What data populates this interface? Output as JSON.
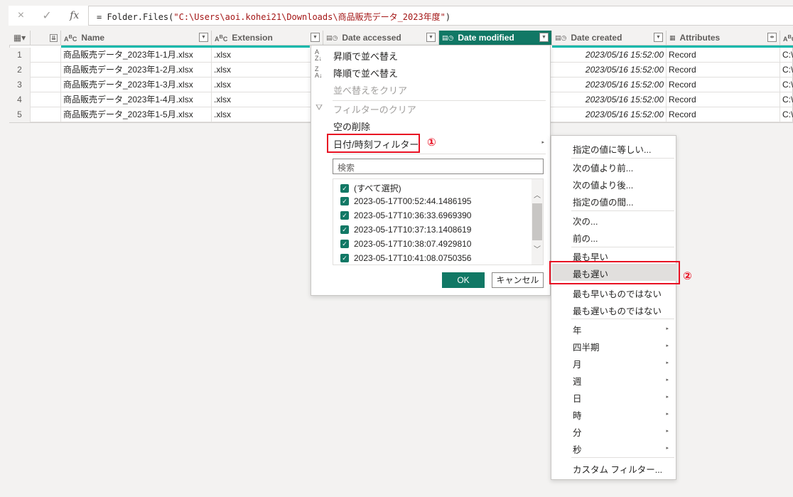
{
  "formula_bar": {
    "cancel_icon": "×",
    "commit_icon": "✓",
    "fx_label": "fx",
    "prefix": "= Folder.Files(",
    "path": "\"C:\\Users\\aoi.kohei21\\Downloads\\商品販売データ_2023年度\"",
    "suffix": ")"
  },
  "columns": [
    {
      "type": "ABC",
      "label": "Name"
    },
    {
      "type": "ABC",
      "label": "Extension"
    },
    {
      "type": "datetime",
      "label": "Date accessed"
    },
    {
      "type": "datetime",
      "label": "Date modified",
      "selected": true
    },
    {
      "type": "datetime",
      "label": "Date created"
    },
    {
      "type": "table",
      "label": "Attributes"
    }
  ],
  "rows": [
    {
      "n": "1",
      "name": "商品販売データ_2023年1-1月.xlsx",
      "ext": ".xlsx",
      "created": "2023/05/16 15:52:00",
      "attr": "Record",
      "path": "C:\\"
    },
    {
      "n": "2",
      "name": "商品販売データ_2023年1-2月.xlsx",
      "ext": ".xlsx",
      "created": "2023/05/16 15:52:00",
      "attr": "Record",
      "path": "C:\\"
    },
    {
      "n": "3",
      "name": "商品販売データ_2023年1-3月.xlsx",
      "ext": ".xlsx",
      "created": "2023/05/16 15:52:00",
      "attr": "Record",
      "path": "C:\\"
    },
    {
      "n": "4",
      "name": "商品販売データ_2023年1-4月.xlsx",
      "ext": ".xlsx",
      "created": "2023/05/16 15:52:00",
      "attr": "Record",
      "path": "C:\\"
    },
    {
      "n": "5",
      "name": "商品販売データ_2023年1-5月.xlsx",
      "ext": ".xlsx",
      "created": "2023/05/16 15:52:00",
      "attr": "Record",
      "path": "C:\\"
    }
  ],
  "menu": {
    "sort_asc": "昇順で並べ替え",
    "sort_desc": "降順で並べ替え",
    "clear_sort": "並べ替えをクリア",
    "clear_filter": "フィルターのクリア",
    "remove_empty": "空の削除",
    "date_filter": "日付/時刻フィルター",
    "annotation1": "①",
    "search_placeholder": "検索",
    "values": [
      "(すべて選択)",
      "2023-05-17T00:52:44.1486195",
      "2023-05-17T10:36:33.6969390",
      "2023-05-17T10:37:13.1408619",
      "2023-05-17T10:38:07.4929810",
      "2023-05-17T10:41:08.0750356"
    ],
    "ok": "OK",
    "cancel": "キャンセル"
  },
  "submenu": {
    "items": [
      "指定の値に等しい...",
      "次の値より前...",
      "次の値より後...",
      "指定の値の間...",
      "次の...",
      "前の...",
      "最も早い",
      "最も遅い",
      "最も早いものではない",
      "最も遅いものではない",
      "年",
      "四半期",
      "月",
      "週",
      "日",
      "時",
      "分",
      "秒",
      "カスタム フィルター..."
    ],
    "highlighted": "最も遅い",
    "annotation2": "②"
  },
  "colors": {
    "accent": "#117865",
    "highlight_box": "#e81123",
    "teal_bar": "#01b8aa"
  }
}
